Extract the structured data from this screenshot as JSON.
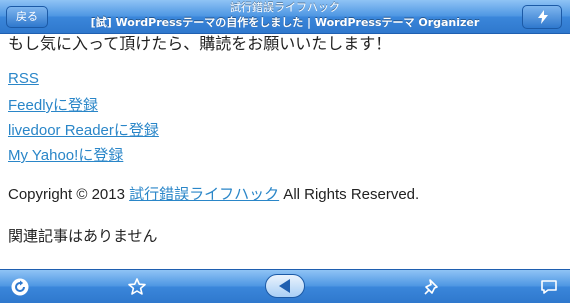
{
  "header": {
    "back_label": "戻る",
    "site_title": "試行錯誤ライフハック",
    "page_title": "[試] WordPressテーマの自作をしました | WordPressテーマ Organizer"
  },
  "content": {
    "cut_text": "もし気に入って頂けたら、購読をお願いいたします！",
    "links": [
      "RSS",
      "Feedlyに登録",
      "livedoor Readerに登録",
      "My Yahoo!に登録"
    ],
    "copyright_prefix": "Copyright © 2013 ",
    "copyright_link": "試行錯誤ライフハック",
    "copyright_suffix": " All Rights Reserved.",
    "related": "関連記事はありません"
  },
  "toolbar": {
    "icons": [
      "refresh-icon",
      "star-icon",
      "back-arrow-icon",
      "pin-icon",
      "comment-icon"
    ]
  }
}
